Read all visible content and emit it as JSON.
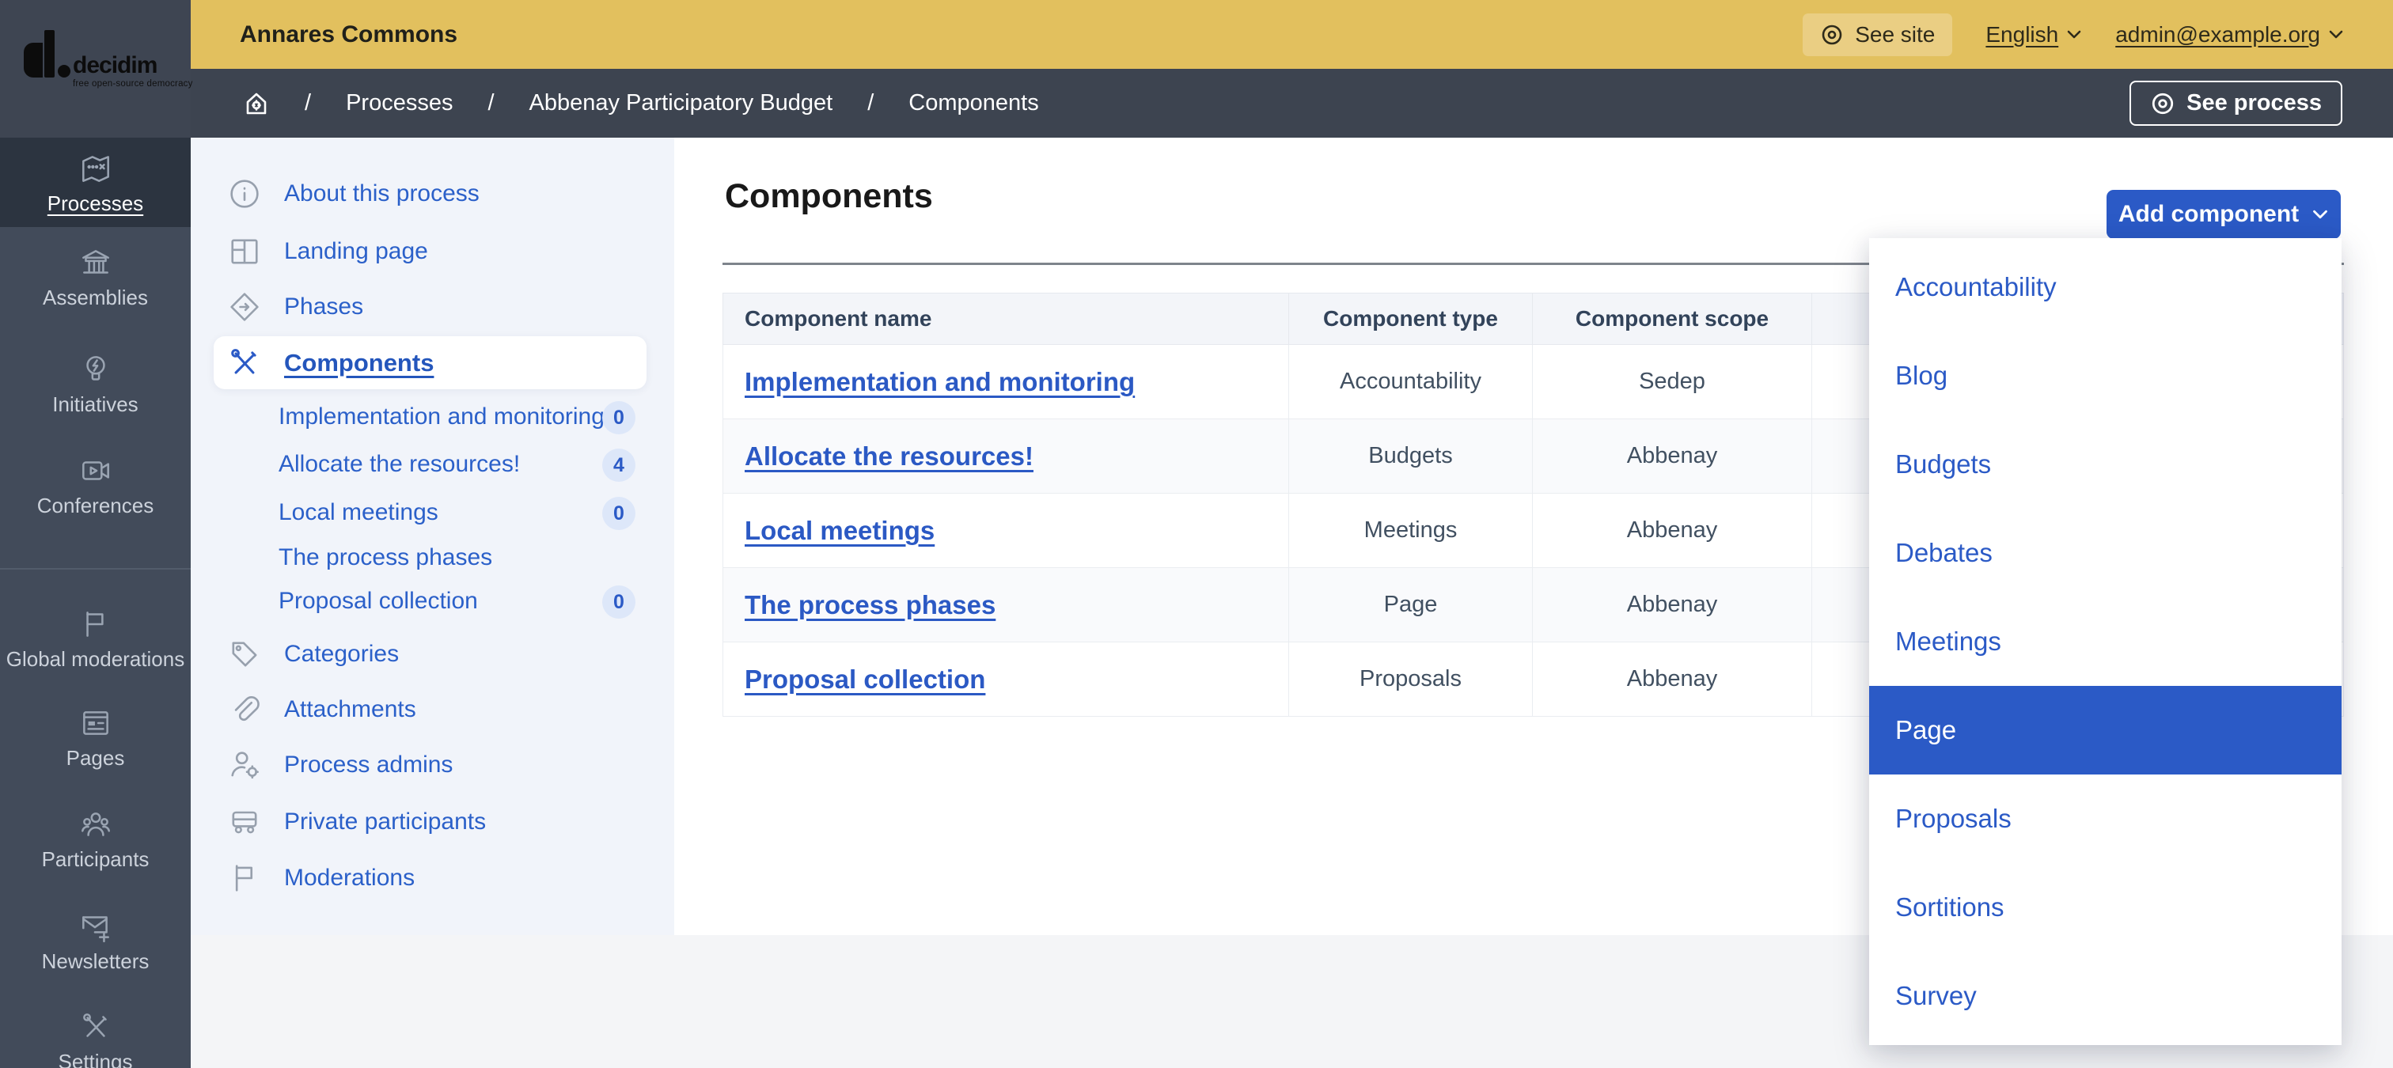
{
  "brand": {
    "logo_text": "decidim",
    "logo_tagline": "free open-source democracy"
  },
  "topbar": {
    "title": "Annares Commons",
    "see_site": "See site",
    "language": "English",
    "user_email": "admin@example.org"
  },
  "breadcrumb": {
    "separator": "/",
    "items": [
      "Processes",
      "Abbenay Participatory Budget",
      "Components"
    ],
    "see_process": "See process"
  },
  "sidebar": {
    "items": [
      {
        "label": "Processes",
        "active": true
      },
      {
        "label": "Assemblies"
      },
      {
        "label": "Initiatives"
      },
      {
        "label": "Conferences"
      },
      {
        "label": "Global moderations"
      },
      {
        "label": "Pages"
      },
      {
        "label": "Participants"
      },
      {
        "label": "Newsletters"
      },
      {
        "label": "Settings"
      }
    ]
  },
  "process_menu": {
    "items": [
      {
        "label": "About this process"
      },
      {
        "label": "Landing page"
      },
      {
        "label": "Phases"
      },
      {
        "label": "Components",
        "selected": true
      },
      {
        "label": "Implementation and monitoring",
        "badge": "0",
        "indent": true
      },
      {
        "label": "Allocate the resources!",
        "badge": "4",
        "indent": true
      },
      {
        "label": "Local meetings",
        "badge": "0",
        "indent": true
      },
      {
        "label": "The process phases",
        "indent": true
      },
      {
        "label": "Proposal collection",
        "badge": "0",
        "indent": true
      },
      {
        "label": "Categories"
      },
      {
        "label": "Attachments"
      },
      {
        "label": "Process admins"
      },
      {
        "label": "Private participants"
      },
      {
        "label": "Moderations"
      }
    ]
  },
  "main": {
    "title": "Components",
    "add_button": "Add component"
  },
  "table": {
    "headers": [
      "Component name",
      "Component type",
      "Component scope"
    ],
    "rows": [
      {
        "name": "Implementation and monitoring",
        "type": "Accountability",
        "scope": "Sedep"
      },
      {
        "name": "Allocate the resources!",
        "type": "Budgets",
        "scope": "Abbenay"
      },
      {
        "name": "Local meetings",
        "type": "Meetings",
        "scope": "Abbenay"
      },
      {
        "name": "The process phases",
        "type": "Page",
        "scope": "Abbenay"
      },
      {
        "name": "Proposal collection",
        "type": "Proposals",
        "scope": "Abbenay"
      }
    ]
  },
  "dropdown": {
    "selected": "Page",
    "items": [
      "Accountability",
      "Blog",
      "Budgets",
      "Debates",
      "Meetings",
      "Page",
      "Proposals",
      "Sortitions",
      "Survey"
    ]
  },
  "colors": {
    "accent_yellow": "#e2c05e",
    "charcoal": "#3d4450",
    "sidebar": "#424b5a",
    "sidebar_active": "#2c3440",
    "primary_blue": "#2b5ac6",
    "menu_bg": "#f1f4fa",
    "page_bg": "#f4f5f7"
  }
}
